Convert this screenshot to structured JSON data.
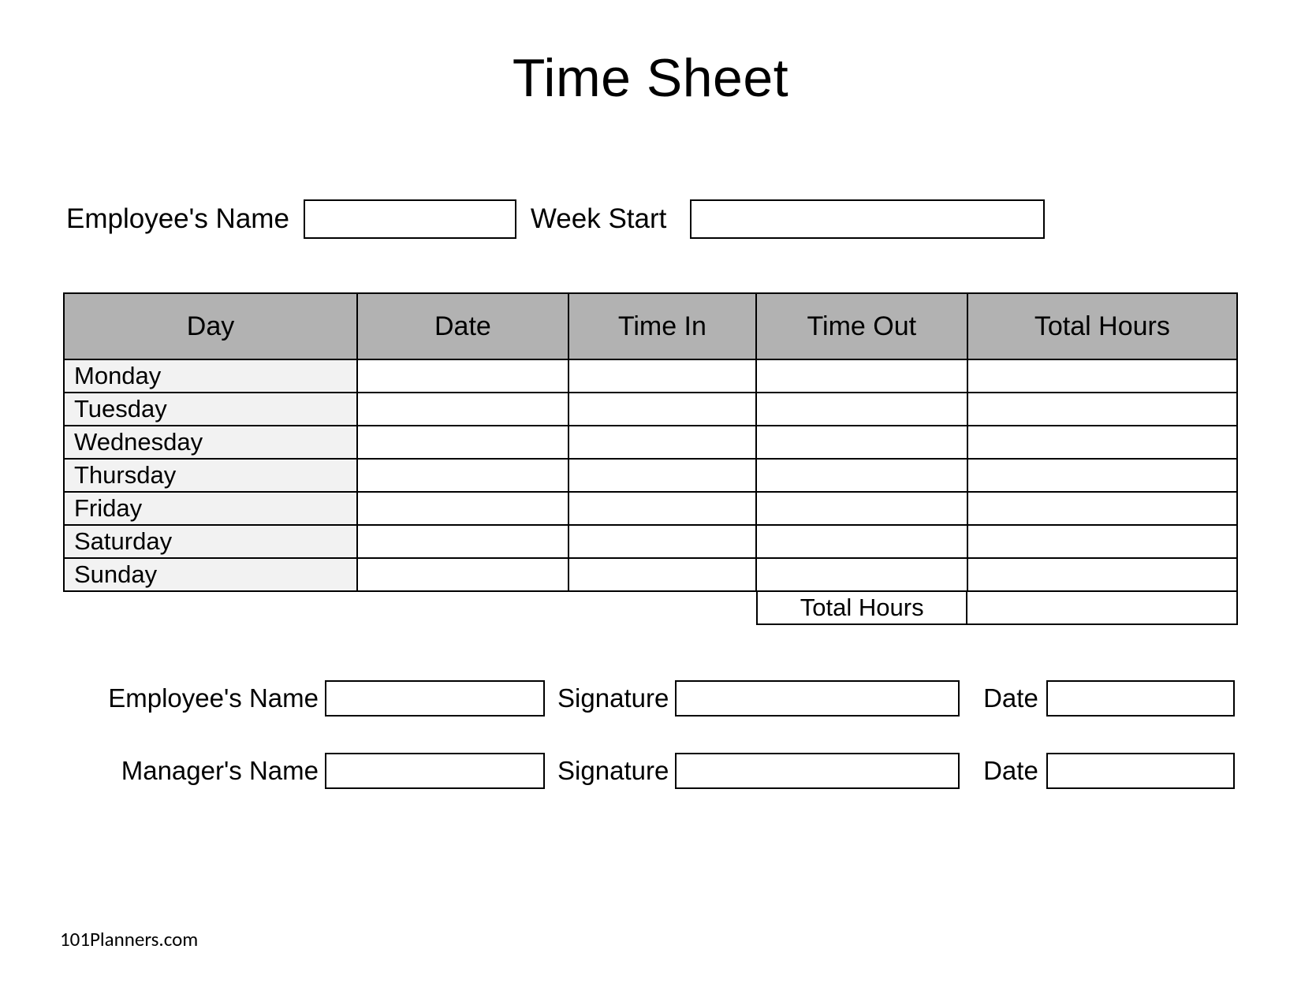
{
  "title": "Time Sheet",
  "top": {
    "employee_label": "Employee's Name",
    "week_start_label": "Week Start"
  },
  "columns": {
    "day": "Day",
    "date": "Date",
    "time_in": "Time In",
    "time_out": "Time Out",
    "total_hours": "Total Hours"
  },
  "days": {
    "mon": "Monday",
    "tue": "Tuesday",
    "wed": "Wednesday",
    "thu": "Thursday",
    "fri": "Friday",
    "sat": "Saturday",
    "sun": "Sunday"
  },
  "total_hours_label": "Total Hours",
  "signatures": {
    "employee_name_label": "Employee's Name",
    "manager_name_label": "Manager's Name",
    "signature_label": "Signature",
    "date_label": "Date"
  },
  "footer": "101Planners.com"
}
